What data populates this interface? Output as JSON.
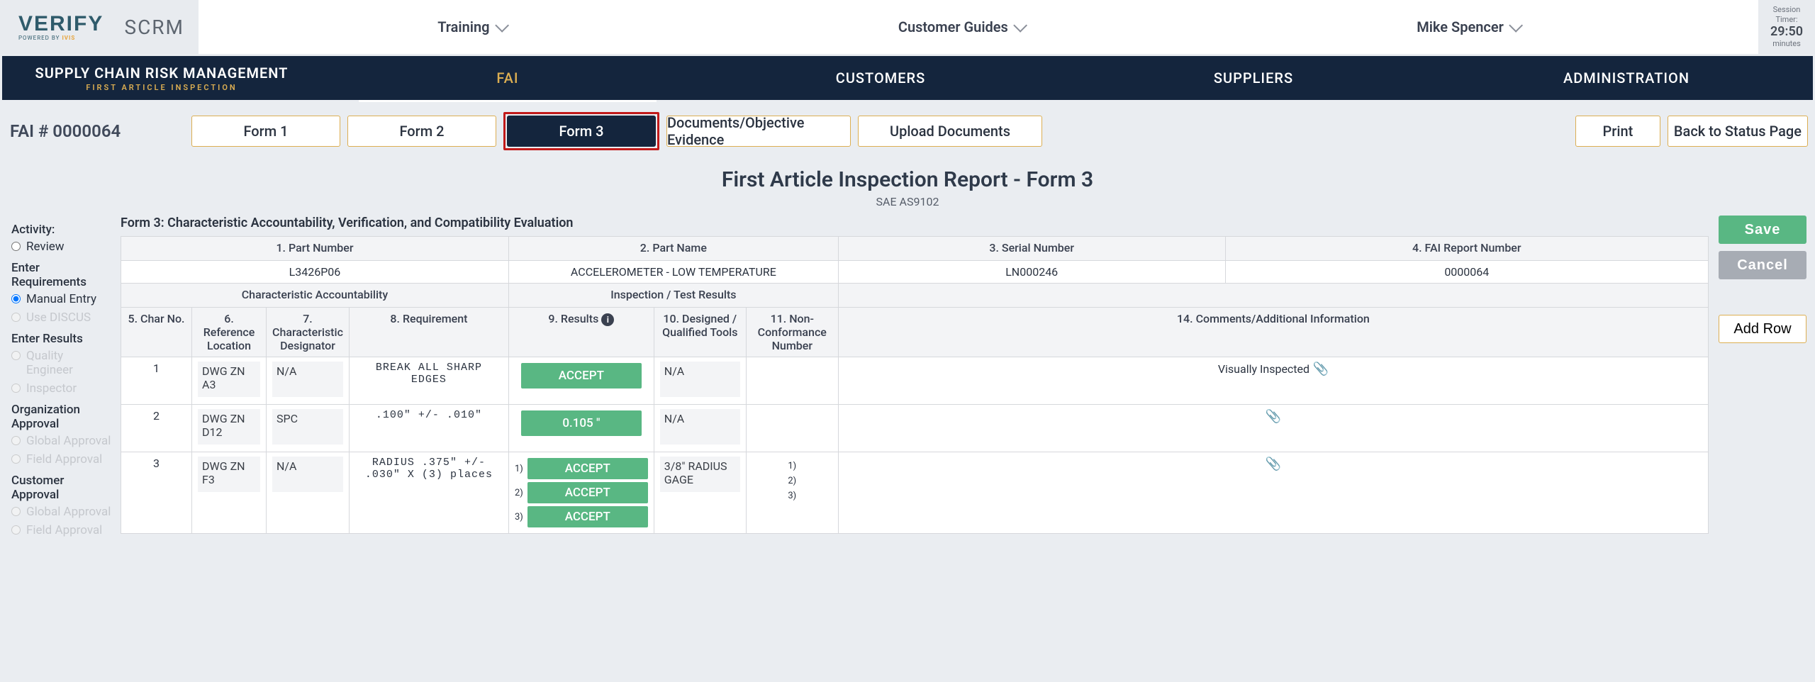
{
  "header": {
    "logo_main": "VERIFY",
    "logo_powered": "POWERED BY ",
    "logo_ivis": "IVIS",
    "scrm": "SCRM",
    "nav": {
      "training": "Training",
      "customer_guides": "Customer Guides",
      "user": "Mike Spencer"
    },
    "session": {
      "label1": "Session",
      "label2": "Timer:",
      "time": "29:50",
      "unit": "minutes"
    }
  },
  "blueNav": {
    "title": "SUPPLY CHAIN RISK MANAGEMENT",
    "subtitle": "FIRST ARTICLE INSPECTION",
    "tabs": {
      "fai": "FAI",
      "customers": "CUSTOMERS",
      "suppliers": "SUPPLIERS",
      "administration": "ADMINISTRATION"
    }
  },
  "subToolbar": {
    "fai_number_label": "FAI # 0000064",
    "form1": "Form 1",
    "form2": "Form 2",
    "form3": "Form 3",
    "docs": "Documents/Objective Evidence",
    "upload": "Upload Documents",
    "print": "Print",
    "back": "Back to Status Page"
  },
  "page": {
    "title": "First Article Inspection Report - Form 3",
    "standard": "SAE AS9102"
  },
  "leftRail": {
    "activity": "Activity:",
    "review": "Review",
    "enter_req": "Enter Requirements",
    "manual": "Manual Entry",
    "discus": "Use DISCUS",
    "enter_res": "Enter Results",
    "quality": "Quality Engineer",
    "inspector": "Inspector",
    "org_app": "Organization Approval",
    "global_app": "Global Approval",
    "field_app": "Field Approval",
    "cust_app": "Customer Approval",
    "global_app2": "Global Approval",
    "field_app2": "Field Approval"
  },
  "rightRail": {
    "save": "Save",
    "cancel": "Cancel",
    "add_row": "Add Row"
  },
  "form": {
    "caption": "Form 3: Characteristic Accountability, Verification, and Compatibility Evaluation",
    "hdr_top": {
      "part_number": "1. Part Number",
      "part_name": "2. Part Name",
      "serial": "3. Serial Number",
      "report": "4. FAI Report Number"
    },
    "vals_top": {
      "part_number": "L3426P06",
      "part_name": "ACCELEROMETER - LOW TEMPERATURE",
      "serial": "LN000246",
      "report": "0000064"
    },
    "hdr_sec": {
      "char_acc": "Characteristic Accountability",
      "insp_test": "Inspection / Test Results"
    },
    "hdr_cols": {
      "c5": "5. Char No.",
      "c6": "6. Reference Location",
      "c7": "7. Characteristic Designator",
      "c8": "8. Requirement",
      "c9": "9. Results",
      "c10": "10. Designed / Qualified Tools",
      "c11": "11. Non-Conformance Number",
      "c14": "14. Comments/Additional Information"
    },
    "rows": [
      {
        "char_no": "1",
        "ref": "DWG ZN A3",
        "desig": "N/A",
        "req": "BREAK ALL SHARP EDGES",
        "results": [
          {
            "label": "ACCEPT"
          }
        ],
        "tool": "N/A",
        "nc": [],
        "comment": "Visually Inspected"
      },
      {
        "char_no": "2",
        "ref": "DWG ZN D12",
        "desig": "SPC",
        "req": ".100\" +/- .010\"",
        "results": [
          {
            "label": "0.105 \""
          }
        ],
        "tool": "N/A",
        "nc": [],
        "comment": ""
      },
      {
        "char_no": "3",
        "ref": "DWG ZN F3",
        "desig": "N/A",
        "req": "RADIUS .375\" +/- .030\" X (3) places",
        "results": [
          {
            "idx": "1)",
            "label": "ACCEPT"
          },
          {
            "idx": "2)",
            "label": "ACCEPT"
          },
          {
            "idx": "3)",
            "label": "ACCEPT"
          }
        ],
        "tool": "3/8\" RADIUS GAGE",
        "nc": [
          "1)",
          "2)",
          "3)"
        ],
        "comment": ""
      }
    ]
  }
}
